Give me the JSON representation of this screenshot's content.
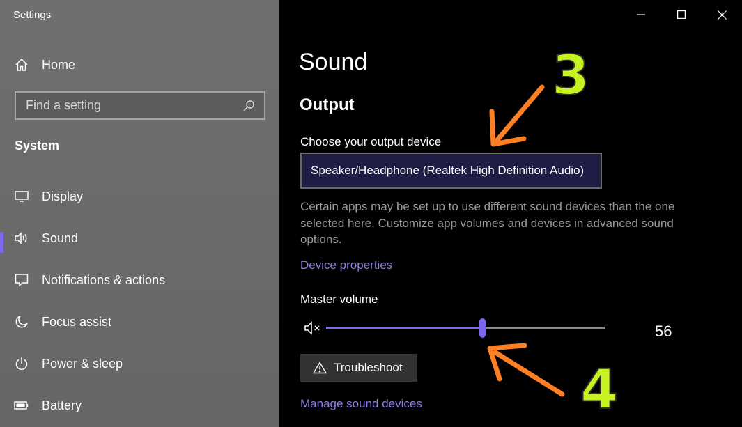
{
  "window": {
    "app_title": "Settings"
  },
  "sidebar": {
    "home_label": "Home",
    "search": {
      "placeholder": "Find a setting"
    },
    "section_heading": "System",
    "items": [
      {
        "label": "Display",
        "icon": "monitor-icon"
      },
      {
        "label": "Sound",
        "icon": "speaker-icon",
        "active": true
      },
      {
        "label": "Notifications & actions",
        "icon": "notification-icon"
      },
      {
        "label": "Focus assist",
        "icon": "moon-icon"
      },
      {
        "label": "Power & sleep",
        "icon": "power-icon"
      },
      {
        "label": "Battery",
        "icon": "battery-icon"
      }
    ]
  },
  "main": {
    "page_title": "Sound",
    "section_title": "Output",
    "output_device_label": "Choose your output device",
    "output_device_value": "Speaker/Headphone (Realtek High Definition Audio)",
    "info_text": "Certain apps may be set up to use different sound devices than the one selected here. Customize app volumes and devices in advanced sound options.",
    "device_properties_link": "Device properties",
    "master_volume_label": "Master volume",
    "volume_value": "56",
    "troubleshoot_label": "Troubleshoot",
    "manage_devices_link": "Manage sound devices"
  },
  "annotations": {
    "step_3": "3",
    "step_4": "4"
  },
  "colors": {
    "accent": "#7b68ee",
    "link": "#8b80e6",
    "annotation_arrow": "#ff7f24",
    "annotation_number": "#c6f221"
  }
}
